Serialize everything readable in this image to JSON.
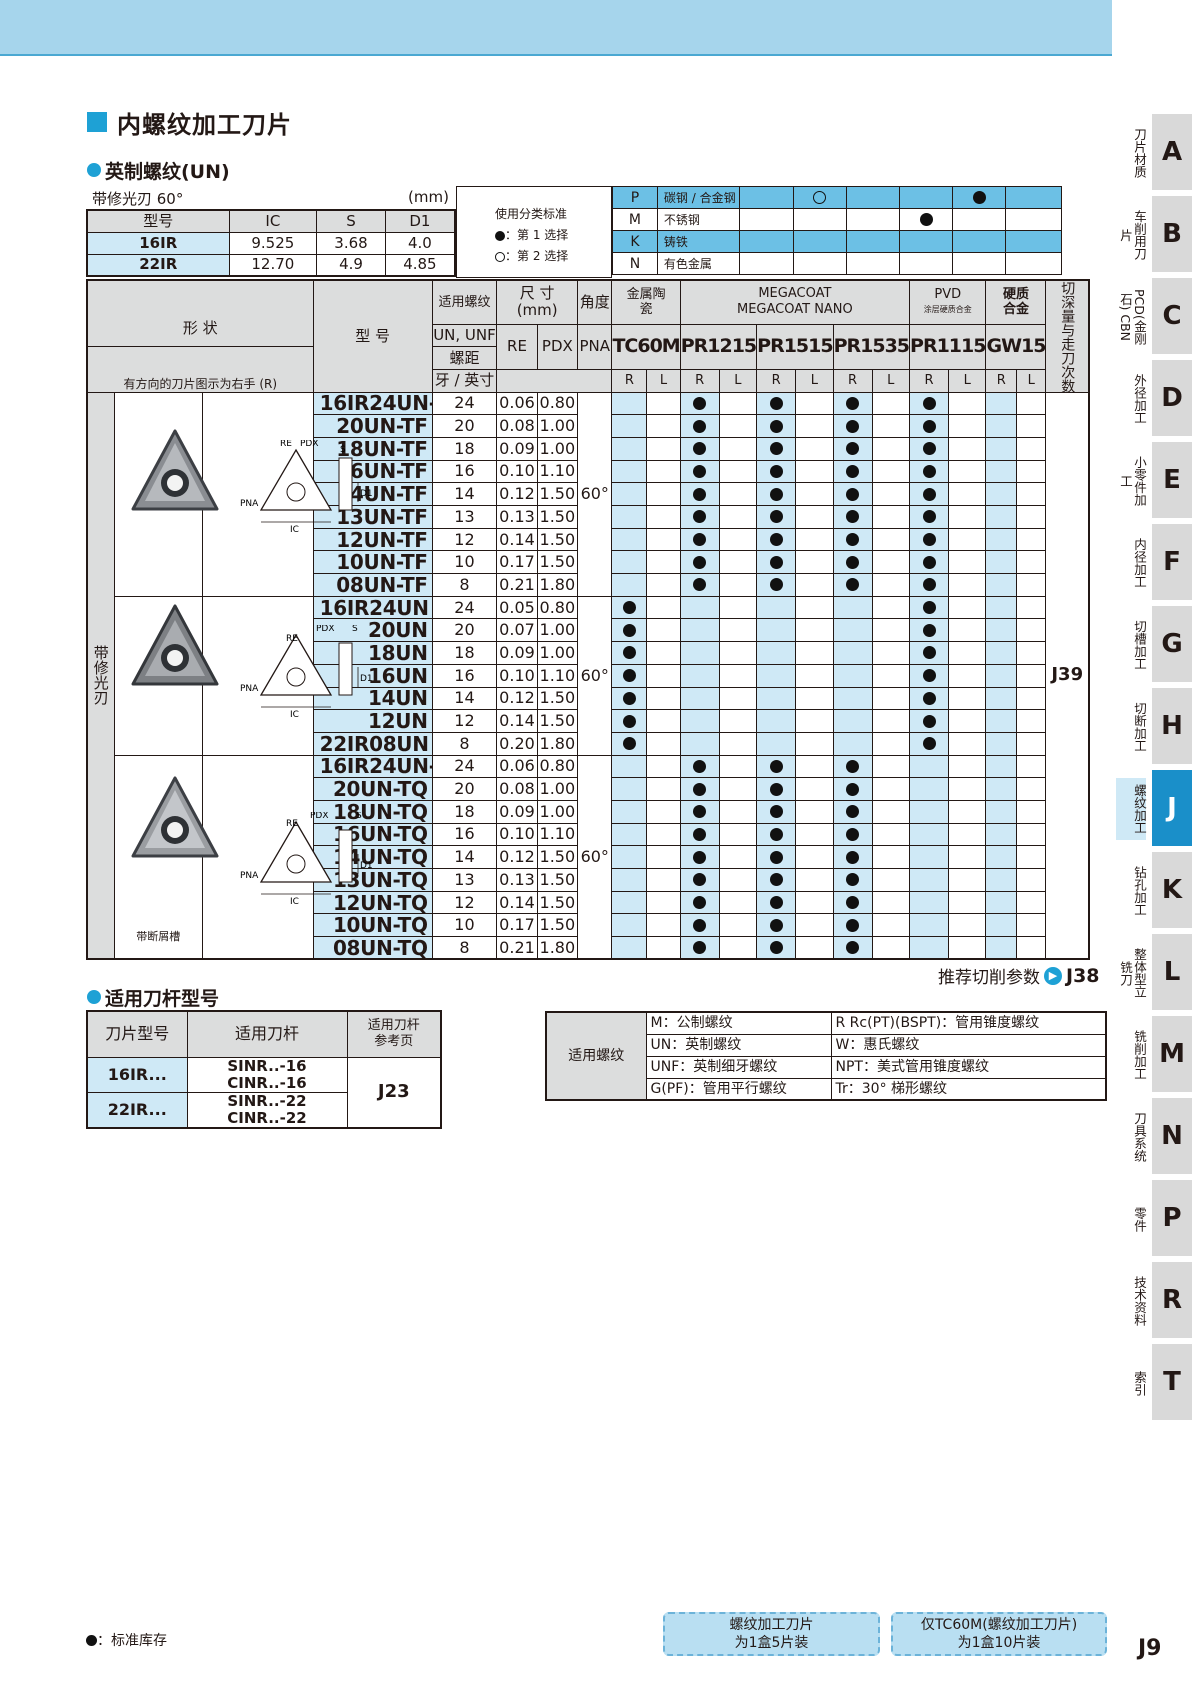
{
  "title": "内螺纹加工刀片",
  "section1": "英制螺纹(UN)",
  "subtitle": "带修光刃 60°",
  "unit": "(mm)",
  "dim_table": {
    "headers": [
      "型号",
      "IC",
      "S",
      "D1"
    ],
    "rows": [
      [
        "16IR",
        "9.525",
        "3.68",
        "4.0"
      ],
      [
        "22IR",
        "12.70",
        "4.9",
        "4.85"
      ]
    ]
  },
  "legend": {
    "title": "使用分类标准",
    "first": "：第 1 选择",
    "second": "：第 2 选择"
  },
  "materials": [
    {
      "code": "P",
      "name": "碳钢 / 合金钢"
    },
    {
      "code": "M",
      "name": "不锈钢"
    },
    {
      "code": "K",
      "name": "铸铁"
    },
    {
      "code": "N",
      "name": "有色金属"
    }
  ],
  "material_marks": {
    "P_open": "○",
    "P_filled": "●",
    "M_filled": "●"
  },
  "depth_ref_label": "切深量与走刀次数参考页",
  "headers": {
    "shape": "形 状",
    "shape_note": "有方向的刀片图示为右手 (R)",
    "model": "型 号",
    "thread": "适用螺纹",
    "un_unf": "UN, UNF",
    "pitch": "螺距",
    "tpi": "牙 / 英寸",
    "size": "尺 寸",
    "size_unit": "(mm)",
    "re": "RE",
    "pdx": "PDX",
    "angle": "角度",
    "pna": "PNA",
    "cermet": "金属陶瓷",
    "megacoat": "MEGACOAT",
    "megacoat_nano": "MEGACOAT NANO",
    "pvd": "PVD",
    "pvd_sub": "涂层硬质合金",
    "carbide": "硬质合金",
    "carbide2": "合金",
    "r": "R",
    "l": "L"
  },
  "grades": [
    "TC60M",
    "PR1215",
    "PR1515",
    "PR1535",
    "PR1115",
    "GW15"
  ],
  "row_label": "带修光刃",
  "chipbreaker_label": "带断屑槽",
  "dia_labels": {
    "re": "RE",
    "pdx": "PDX",
    "s": "S",
    "d1": "D1",
    "pna": "PNA",
    "ic": "IC"
  },
  "groups": [
    {
      "angle": "60°",
      "rows": [
        {
          "prefix": "16IR",
          "model": "24UN-TF",
          "tpi": "24",
          "re": "0.06",
          "pdx": "0.80",
          "marks": [
            0,
            1,
            1,
            1,
            1,
            0
          ]
        },
        {
          "prefix": "",
          "model": "20UN-TF",
          "tpi": "20",
          "re": "0.08",
          "pdx": "1.00",
          "marks": [
            0,
            1,
            1,
            1,
            1,
            0
          ]
        },
        {
          "prefix": "",
          "model": "18UN-TF",
          "tpi": "18",
          "re": "0.09",
          "pdx": "1.00",
          "marks": [
            0,
            1,
            1,
            1,
            1,
            0
          ]
        },
        {
          "prefix": "",
          "model": "16UN-TF",
          "tpi": "16",
          "re": "0.10",
          "pdx": "1.10",
          "marks": [
            0,
            1,
            1,
            1,
            1,
            0
          ]
        },
        {
          "prefix": "",
          "model": "14UN-TF",
          "tpi": "14",
          "re": "0.12",
          "pdx": "1.50",
          "marks": [
            0,
            1,
            1,
            1,
            1,
            0
          ]
        },
        {
          "prefix": "",
          "model": "13UN-TF",
          "tpi": "13",
          "re": "0.13",
          "pdx": "1.50",
          "marks": [
            0,
            1,
            1,
            1,
            1,
            0
          ]
        },
        {
          "prefix": "",
          "model": "12UN-TF",
          "tpi": "12",
          "re": "0.14",
          "pdx": "1.50",
          "marks": [
            0,
            1,
            1,
            1,
            1,
            0
          ]
        },
        {
          "prefix": "",
          "model": "10UN-TF",
          "tpi": "10",
          "re": "0.17",
          "pdx": "1.50",
          "marks": [
            0,
            1,
            1,
            1,
            1,
            0
          ]
        },
        {
          "prefix": "",
          "model": "08UN-TF",
          "tpi": "8",
          "re": "0.21",
          "pdx": "1.80",
          "marks": [
            0,
            1,
            1,
            1,
            1,
            0
          ]
        }
      ]
    },
    {
      "angle": "60°",
      "rows": [
        {
          "prefix": "16IR",
          "model": "24UN",
          "tpi": "24",
          "re": "0.05",
          "pdx": "0.80",
          "marks": [
            1,
            0,
            0,
            0,
            1,
            0
          ]
        },
        {
          "prefix": "",
          "model": "20UN",
          "tpi": "20",
          "re": "0.07",
          "pdx": "1.00",
          "marks": [
            1,
            0,
            0,
            0,
            1,
            0
          ]
        },
        {
          "prefix": "",
          "model": "18UN",
          "tpi": "18",
          "re": "0.09",
          "pdx": "1.00",
          "marks": [
            1,
            0,
            0,
            0,
            1,
            0
          ]
        },
        {
          "prefix": "",
          "model": "16UN",
          "tpi": "16",
          "re": "0.10",
          "pdx": "1.10",
          "marks": [
            1,
            0,
            0,
            0,
            1,
            0
          ]
        },
        {
          "prefix": "",
          "model": "14UN",
          "tpi": "14",
          "re": "0.12",
          "pdx": "1.50",
          "marks": [
            1,
            0,
            0,
            0,
            1,
            0
          ]
        },
        {
          "prefix": "",
          "model": "12UN",
          "tpi": "12",
          "re": "0.14",
          "pdx": "1.50",
          "marks": [
            1,
            0,
            0,
            0,
            1,
            0
          ]
        },
        {
          "prefix": "22IR",
          "model": "08UN",
          "tpi": "8",
          "re": "0.20",
          "pdx": "1.80",
          "marks": [
            1,
            0,
            0,
            0,
            1,
            0
          ]
        }
      ]
    },
    {
      "angle": "60°",
      "rows": [
        {
          "prefix": "16IR",
          "model": "24UN-TQ",
          "tpi": "24",
          "re": "0.06",
          "pdx": "0.80",
          "marks": [
            0,
            1,
            1,
            1,
            0,
            0
          ]
        },
        {
          "prefix": "",
          "model": "20UN-TQ",
          "tpi": "20",
          "re": "0.08",
          "pdx": "1.00",
          "marks": [
            0,
            1,
            1,
            1,
            0,
            0
          ]
        },
        {
          "prefix": "",
          "model": "18UN-TQ",
          "tpi": "18",
          "re": "0.09",
          "pdx": "1.00",
          "marks": [
            0,
            1,
            1,
            1,
            0,
            0
          ]
        },
        {
          "prefix": "",
          "model": "16UN-TQ",
          "tpi": "16",
          "re": "0.10",
          "pdx": "1.10",
          "marks": [
            0,
            1,
            1,
            1,
            0,
            0
          ]
        },
        {
          "prefix": "",
          "model": "14UN-TQ",
          "tpi": "14",
          "re": "0.12",
          "pdx": "1.50",
          "marks": [
            0,
            1,
            1,
            1,
            0,
            0
          ]
        },
        {
          "prefix": "",
          "model": "13UN-TQ",
          "tpi": "13",
          "re": "0.13",
          "pdx": "1.50",
          "marks": [
            0,
            1,
            1,
            1,
            0,
            0
          ]
        },
        {
          "prefix": "",
          "model": "12UN-TQ",
          "tpi": "12",
          "re": "0.14",
          "pdx": "1.50",
          "marks": [
            0,
            1,
            1,
            1,
            0,
            0
          ]
        },
        {
          "prefix": "",
          "model": "10UN-TQ",
          "tpi": "10",
          "re": "0.17",
          "pdx": "1.50",
          "marks": [
            0,
            1,
            1,
            1,
            0,
            0
          ]
        },
        {
          "prefix": "",
          "model": "08UN-TQ",
          "tpi": "8",
          "re": "0.21",
          "pdx": "1.80",
          "marks": [
            0,
            1,
            1,
            1,
            0,
            0
          ]
        }
      ]
    }
  ],
  "ref_page": "J39",
  "cutting_ref": {
    "text": "推荐切削参数",
    "page": "J38"
  },
  "section2": "适用刀杆型号",
  "holder_table": {
    "headers": [
      "刀片型号",
      "适用刀杆",
      "适用刀杆参考页"
    ],
    "rows": [
      {
        "insert": "16IR...",
        "holders": [
          "SINR..-16",
          "CINR..-16"
        ]
      },
      {
        "insert": "22IR...",
        "holders": [
          "SINR..-22",
          "CINR..-22"
        ]
      }
    ],
    "ref": "J23"
  },
  "thread_table": {
    "label": "适用螺纹",
    "items": [
      [
        "M：公制螺纹",
        "R Rc(PT)(BSPT)：管用锥度螺纹"
      ],
      [
        "UN：英制螺纹",
        "W：惠氏螺纹"
      ],
      [
        "UNF：英制细牙螺纹",
        "NPT：美式管用锥度螺纹"
      ],
      [
        "G(PF)：管用平行螺纹",
        "Tr：30° 梯形螺纹"
      ]
    ]
  },
  "footnote": "：标准库存",
  "buttons": [
    {
      "line1": "螺纹加工刀片",
      "line2": "为1盒5片装"
    },
    {
      "line1": "仅TC60M(螺纹加工刀片)",
      "line2": "为1盒10片装"
    }
  ],
  "page_number": "J9",
  "tabs": [
    {
      "letter": "A",
      "label": "刀片材质"
    },
    {
      "letter": "B",
      "label": "车削用刀片"
    },
    {
      "letter": "C",
      "label": "PCD(金刚石) CBN"
    },
    {
      "letter": "D",
      "label": "外径加工"
    },
    {
      "letter": "E",
      "label": "小零件加工"
    },
    {
      "letter": "F",
      "label": "内径加工"
    },
    {
      "letter": "G",
      "label": "切槽加工"
    },
    {
      "letter": "H",
      "label": "切断加工"
    },
    {
      "letter": "J",
      "label": "螺纹加工"
    },
    {
      "letter": "K",
      "label": "钻孔加工"
    },
    {
      "letter": "L",
      "label": "整体型立铣刀"
    },
    {
      "letter": "M",
      "label": "铣削加工"
    },
    {
      "letter": "N",
      "label": "刀具系统"
    },
    {
      "letter": "P",
      "label": "零件"
    },
    {
      "letter": "R",
      "label": "技术资料"
    },
    {
      "letter": "T",
      "label": "索引"
    }
  ],
  "colors": {
    "accent": "#1ea1d5",
    "header_blue": "#a6d5ec",
    "light_blue": "#cfe9f6",
    "column_blue": "#6cc0e5",
    "active_tab": "#1a8fc9",
    "tab_gray": "#d9d9d9"
  }
}
